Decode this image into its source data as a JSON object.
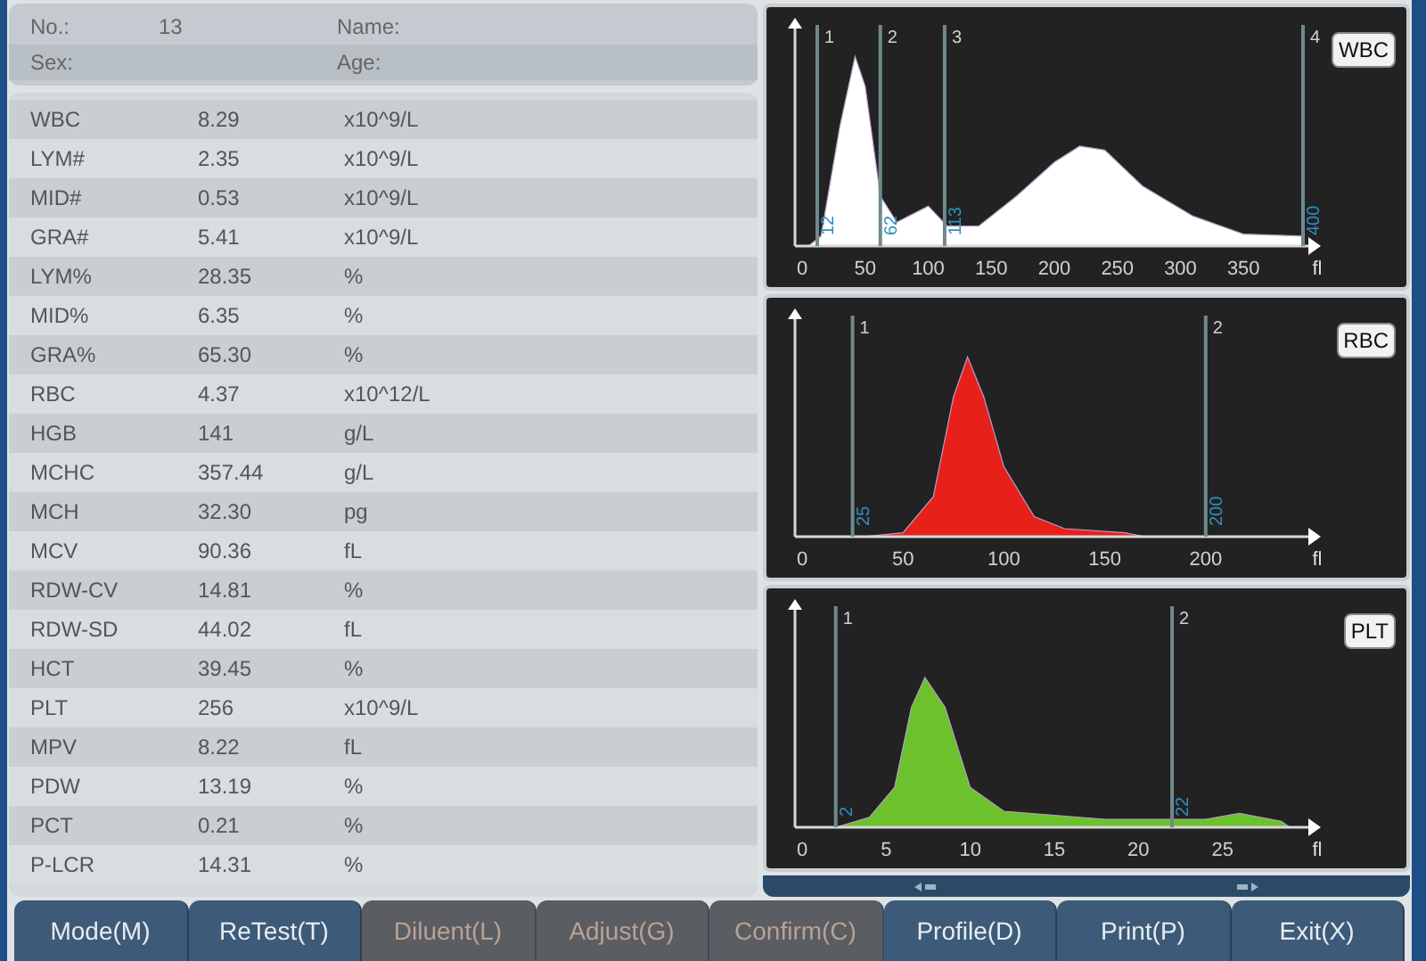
{
  "patient": {
    "no_label": "No.:",
    "no_value": "13",
    "name_label": "Name:",
    "sex_label": "Sex:",
    "age_label": "Age:"
  },
  "results": [
    {
      "name": "WBC",
      "value": "8.29",
      "unit": "x10^9/L"
    },
    {
      "name": "LYM#",
      "value": "2.35",
      "unit": "x10^9/L"
    },
    {
      "name": "MID#",
      "value": "0.53",
      "unit": "x10^9/L"
    },
    {
      "name": "GRA#",
      "value": "5.41",
      "unit": "x10^9/L"
    },
    {
      "name": "LYM%",
      "value": "28.35",
      "unit": "%"
    },
    {
      "name": "MID%",
      "value": "6.35",
      "unit": "%"
    },
    {
      "name": "GRA%",
      "value": "65.30",
      "unit": "%"
    },
    {
      "name": "RBC",
      "value": "4.37",
      "unit": "x10^12/L"
    },
    {
      "name": "HGB",
      "value": "141",
      "unit": "g/L"
    },
    {
      "name": "MCHC",
      "value": "357.44",
      "unit": "g/L"
    },
    {
      "name": "MCH",
      "value": "32.30",
      "unit": "pg"
    },
    {
      "name": "MCV",
      "value": "90.36",
      "unit": "fL"
    },
    {
      "name": "RDW-CV",
      "value": "14.81",
      "unit": "%"
    },
    {
      "name": "RDW-SD",
      "value": "44.02",
      "unit": "fL"
    },
    {
      "name": "HCT",
      "value": "39.45",
      "unit": "%"
    },
    {
      "name": "PLT",
      "value": "256",
      "unit": "x10^9/L"
    },
    {
      "name": "MPV",
      "value": "8.22",
      "unit": "fL"
    },
    {
      "name": "PDW",
      "value": "13.19",
      "unit": "%"
    },
    {
      "name": "PCT",
      "value": "0.21",
      "unit": "%"
    },
    {
      "name": "P-LCR",
      "value": "14.31",
      "unit": "%"
    }
  ],
  "histograms": [
    {
      "kind": "wbc",
      "label": "WBC",
      "color": "#ffffff",
      "unit": "fl",
      "xticks": [
        "0",
        "50",
        "100",
        "150",
        "200",
        "250",
        "300",
        "350"
      ],
      "markers": [
        {
          "number": "1",
          "value": "12"
        },
        {
          "number": "2",
          "value": "62"
        },
        {
          "number": "3",
          "value": "113"
        },
        {
          "number": "4",
          "value": "400"
        }
      ]
    },
    {
      "kind": "rbc",
      "label": "RBC",
      "color": "#e8201a",
      "unit": "fl",
      "xticks": [
        "0",
        "50",
        "100",
        "150",
        "200"
      ],
      "markers": [
        {
          "number": "1",
          "value": "25"
        },
        {
          "number": "2",
          "value": "200"
        }
      ]
    },
    {
      "kind": "plt",
      "label": "PLT",
      "color": "#6cc12c",
      "unit": "fl",
      "xticks": [
        "0",
        "5",
        "10",
        "15",
        "20",
        "25"
      ],
      "markers": [
        {
          "number": "1",
          "value": "2"
        },
        {
          "number": "2",
          "value": "22"
        }
      ]
    }
  ],
  "buttons": [
    {
      "label": "Mode(M)",
      "disabled": false
    },
    {
      "label": "ReTest(T)",
      "disabled": false
    },
    {
      "label": "Diluent(L)",
      "disabled": true
    },
    {
      "label": "Adjust(G)",
      "disabled": true
    },
    {
      "label": "Confirm(C)",
      "disabled": true
    },
    {
      "label": "Profile(D)",
      "disabled": false
    },
    {
      "label": "Print(P)",
      "disabled": false
    },
    {
      "label": "Exit(X)",
      "disabled": false
    }
  ]
}
